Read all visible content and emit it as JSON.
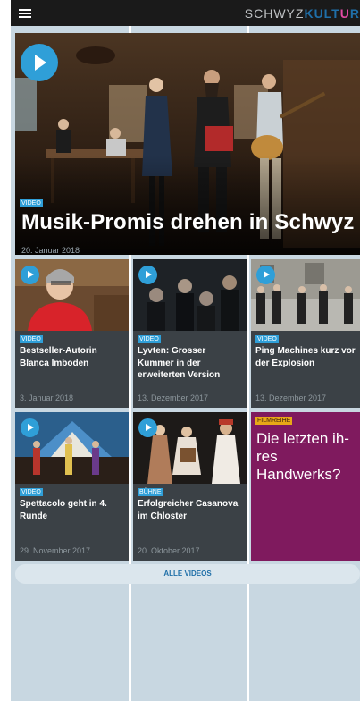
{
  "header": {
    "brand_light": "SCHWYZ",
    "brand_bold_1": "KULT",
    "brand_bold_2": "U",
    "brand_bold_3": "R",
    "menu_icon": "hamburger-icon"
  },
  "colors": {
    "accent": "#2f9fd8",
    "brand_blue": "#1f6fa8",
    "brand_pink": "#e24aa4",
    "card_dark": "#3b4146",
    "card_purple": "#7f1a5e",
    "tag_yellow": "#e8a817",
    "page_bg": "#c8d7e1"
  },
  "hero": {
    "tag": "VIDEO",
    "title": "Musik-Promis drehen in Schwyz",
    "date": "20. Januar 2018",
    "icon": "play-icon"
  },
  "cards": [
    {
      "tag": "VIDEO",
      "title": "Bestseller-Autorin Blanca Imboden",
      "date": "3. Januar 2018"
    },
    {
      "tag": "VIDEO",
      "title": "Lyvten: Grosser Kummer in der erweiterten Version",
      "date": "13. Dezember 2017"
    },
    {
      "tag": "VIDEO",
      "title": "Ping Machines kurz vor der Explosion",
      "date": "13. Dezember 2017"
    },
    {
      "tag": "VIDEO",
      "title": "Spettacolo geht in 4. Runde",
      "date": "29. November 2017"
    },
    {
      "tag": "BÜHNE",
      "title": "Erfolgreicher Casanova im Chloster",
      "date": "20. Oktober 2017"
    },
    {
      "tag": "FILMREIHE",
      "title": "Die letzten ih-res Handwerks?"
    }
  ],
  "all_videos": {
    "label": "ALLE VIDEOS"
  }
}
